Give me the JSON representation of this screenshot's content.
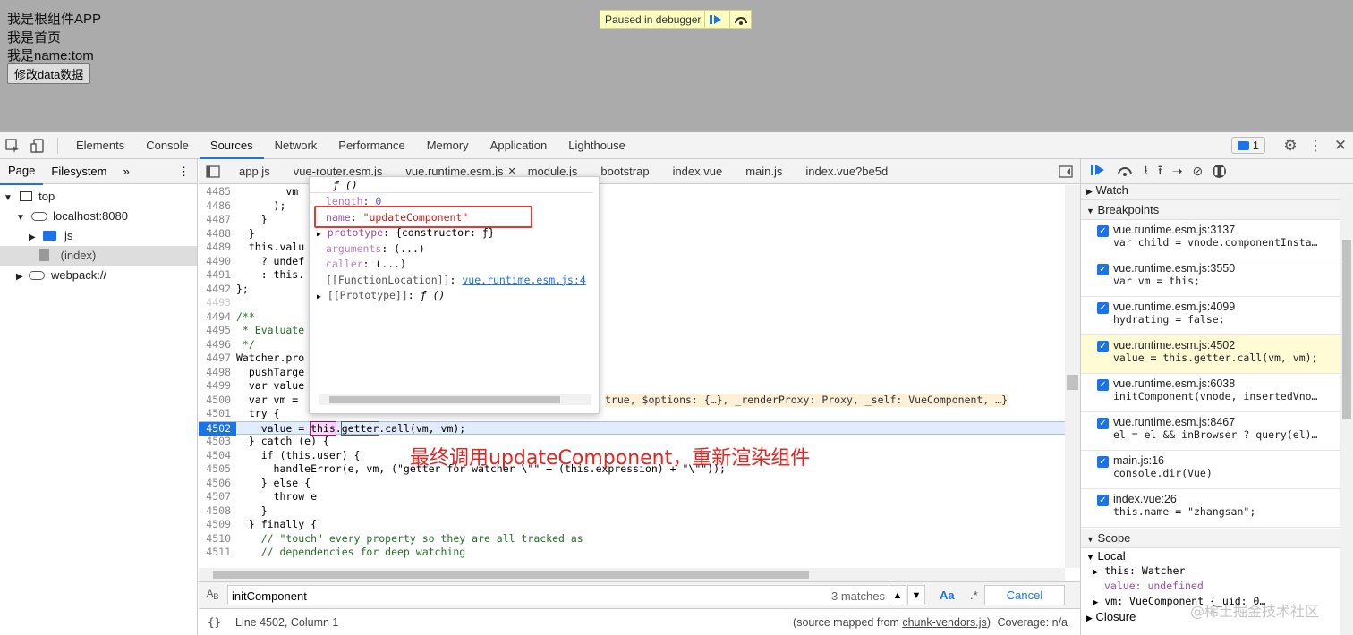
{
  "app": {
    "line1": "我是根组件APP",
    "line2": "我是首页",
    "line3": "我是name:tom",
    "button_label": "修改data数据"
  },
  "debugger_banner": "Paused in debugger",
  "devtools_tabs": [
    "Elements",
    "Console",
    "Sources",
    "Network",
    "Performance",
    "Memory",
    "Application",
    "Lighthouse"
  ],
  "active_tab": "Sources",
  "issues_count": "1",
  "navigator": {
    "tabs": [
      "Page",
      "Filesystem"
    ],
    "more": "»",
    "tree": [
      {
        "label": "top",
        "level": 0,
        "icon": "frame-icon"
      },
      {
        "label": "localhost:8080",
        "level": 1,
        "icon": "cloud-icon"
      },
      {
        "label": "js",
        "level": 2,
        "icon": "folder-icon"
      },
      {
        "label": "(index)",
        "level": 2,
        "icon": "file-icon"
      },
      {
        "label": "webpack://",
        "level": 0,
        "icon": "cloud-icon"
      }
    ]
  },
  "file_tabs": [
    "app.js",
    "vue-router.esm.js",
    "vue.runtime.esm.js",
    "module.js",
    "bootstrap",
    "index.vue",
    "main.js",
    "index.vue?be5d"
  ],
  "code_lines": [
    {
      "n": "4485",
      "t": "        vm"
    },
    {
      "n": "4486",
      "t": "      );"
    },
    {
      "n": "4487",
      "t": "    }"
    },
    {
      "n": "4488",
      "t": "  }"
    },
    {
      "n": "4489",
      "t": "  this.valu"
    },
    {
      "n": "4490",
      "t": "    ? undef"
    },
    {
      "n": "4491",
      "t": "    : this."
    },
    {
      "n": "4492",
      "t": "};"
    },
    {
      "n": "4493",
      "t": ""
    },
    {
      "n": "4494",
      "t": "/**"
    },
    {
      "n": "4495",
      "t": " * Evaluate"
    },
    {
      "n": "4496",
      "t": " */"
    },
    {
      "n": "4497",
      "t": "Watcher.pro"
    },
    {
      "n": "4498",
      "t": "  pushTarge"
    },
    {
      "n": "4499",
      "t": "  var value"
    },
    {
      "n": "4500",
      "t": "  var vm ="
    },
    {
      "n": "4501",
      "t": "  try {"
    },
    {
      "n": "4502",
      "t": "    value = this.getter.call(vm, vm);"
    },
    {
      "n": "4503",
      "t": "  } catch (e) {"
    },
    {
      "n": "4504",
      "t": "    if (this.user) {"
    },
    {
      "n": "4505",
      "t": "      handleError(e, vm, (\"getter for watcher \\\"\" + (this.expression) + \"\\\"\"));"
    },
    {
      "n": "4506",
      "t": "    } else {"
    },
    {
      "n": "4507",
      "t": "      throw e"
    },
    {
      "n": "4508",
      "t": "    }"
    },
    {
      "n": "4509",
      "t": "  } finally {"
    },
    {
      "n": "4510",
      "t": "    // \"touch\" every property so they are all tracked as"
    },
    {
      "n": "4511",
      "t": "    // dependencies for deep watching"
    }
  ],
  "inline_value_4500": "true, $options: {…}, _renderProxy: Proxy, _self: VueComponent, …}",
  "popup": {
    "header": "ƒ ()",
    "rows": [
      {
        "k": "length",
        "v": "0"
      },
      {
        "k": "name",
        "v": "\"updateComponent\""
      },
      {
        "k": "prototype",
        "v": "{constructor: ƒ}"
      },
      {
        "k": "arguments",
        "v": "(...)"
      },
      {
        "k": "caller",
        "v": "(...)"
      },
      {
        "k": "[[FunctionLocation]]",
        "v": "vue.runtime.esm.js:4"
      },
      {
        "k": "[[Prototype]]",
        "v": "ƒ ()"
      }
    ]
  },
  "annotation": "最终调用updateComponent，重新渲染组件",
  "search": {
    "value": "initComponent",
    "matches": "3 matches",
    "case_label": "Aa",
    "regex_label": ".*",
    "cancel": "Cancel"
  },
  "status": {
    "position": "Line 4502, Column 1",
    "source_map_prefix": "(source mapped from ",
    "source_map_link": "chunk-vendors.js",
    "source_map_suffix": ")",
    "coverage": "Coverage: n/a"
  },
  "right_panel": {
    "watch": "Watch",
    "breakpoints_title": "Breakpoints",
    "breakpoints": [
      {
        "file": "vue.runtime.esm.js:3137",
        "code": "var child = vnode.componentInsta…",
        "hit": false
      },
      {
        "file": "vue.runtime.esm.js:3550",
        "code": "var vm = this;",
        "hit": false
      },
      {
        "file": "vue.runtime.esm.js:4099",
        "code": "hydrating = false;",
        "hit": false
      },
      {
        "file": "vue.runtime.esm.js:4502",
        "code": "value = this.getter.call(vm, vm);",
        "hit": true
      },
      {
        "file": "vue.runtime.esm.js:6038",
        "code": "initComponent(vnode, insertedVno…",
        "hit": false
      },
      {
        "file": "vue.runtime.esm.js:8467",
        "code": "el = el && inBrowser ? query(el)…",
        "hit": false
      },
      {
        "file": "main.js:16",
        "code": "console.dir(Vue)",
        "hit": false
      },
      {
        "file": "index.vue:26",
        "code": "this.name = \"zhangsan\";",
        "hit": false
      }
    ],
    "scope_title": "Scope",
    "local": "Local",
    "scope_rows": [
      "this: Watcher",
      "value: undefined",
      "vm: VueComponent {_uid: 0…"
    ],
    "closure": "Closure"
  },
  "watermark": "@稀土掘金技术社区"
}
